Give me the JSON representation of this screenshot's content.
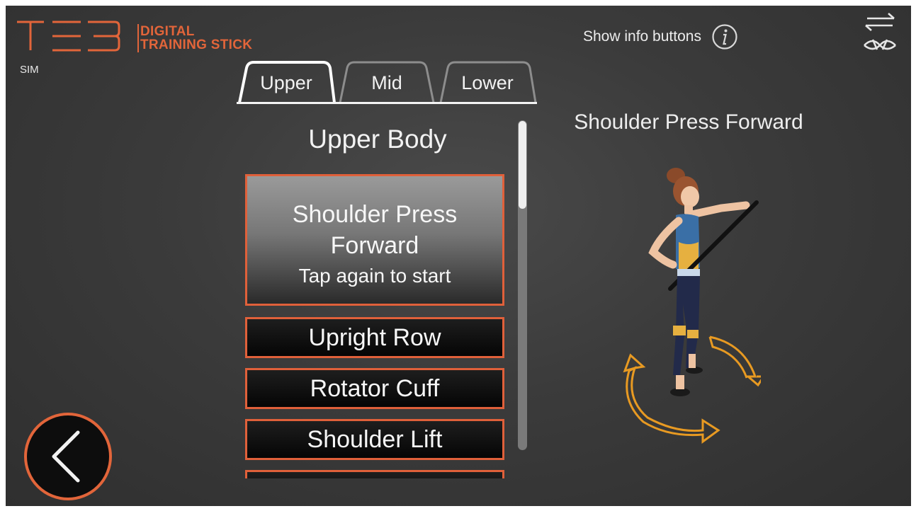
{
  "brand": {
    "logo_text": "TEB",
    "line1": "DIGITAL",
    "line2": "TRAINING STICK",
    "mode": "SIM",
    "accent": "#e2653a"
  },
  "header": {
    "info_toggle_label": "Show info buttons",
    "info_icon": "info-icon",
    "settings_icon": "settings-swap-icon"
  },
  "tabs": [
    {
      "label": "Upper",
      "active": true
    },
    {
      "label": "Mid",
      "active": false
    },
    {
      "label": "Lower",
      "active": false
    }
  ],
  "exercise_list": {
    "title": "Upper Body",
    "selected": {
      "name": "Shoulder Press Forward",
      "hint": "Tap again to start"
    },
    "items": [
      "Upright Row",
      "Rotator Cuff",
      "Shoulder Lift"
    ]
  },
  "preview": {
    "title": "Shoulder Press Forward",
    "rotate_icon": "rotate-arrow-icon"
  },
  "navigation": {
    "back_icon": "chevron-left-icon"
  }
}
